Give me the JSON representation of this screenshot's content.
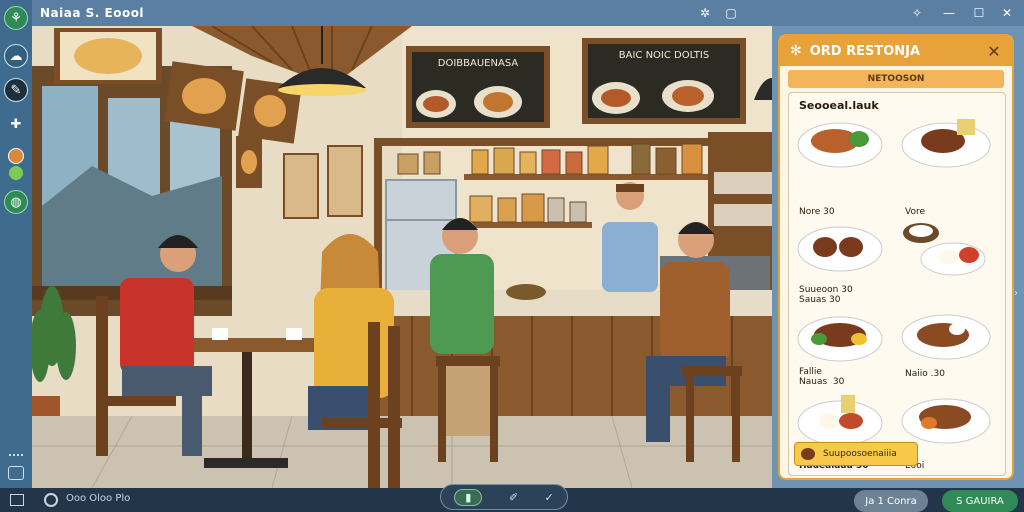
{
  "window": {
    "title": "Naiaa  S. Eoool"
  },
  "menu": {
    "title": "ORD RESTONJA",
    "subtitle": "NETOOSON",
    "section": "Seooeal.lauk",
    "dishes": [
      {
        "label": "Nore 30"
      },
      {
        "label": "Vore"
      },
      {
        "label": "Suueoon 30\nSauas 30"
      },
      {
        "label": ""
      },
      {
        "label": "Fallie\nNauas  30"
      },
      {
        "label": "Naiio .30"
      },
      {
        "label": "Haueaiaau 30"
      },
      {
        "label": "Eooi"
      }
    ],
    "footer_button": "Suupoosoenaiiia"
  },
  "scene": {
    "board_left_title": "DOIBBAUENASA",
    "board_right_title": "BAIC  NOIC DOLTIS"
  },
  "taskbar": {
    "status": "Ooo  Oloo  Plo",
    "right_button_1": "Ja 1 Conra",
    "right_button_2": "S  GAUIRA"
  },
  "colors": {
    "accent": "#e8a23a",
    "titlebar": "#5a7fa3",
    "sidebar": "#3f6b8f"
  }
}
